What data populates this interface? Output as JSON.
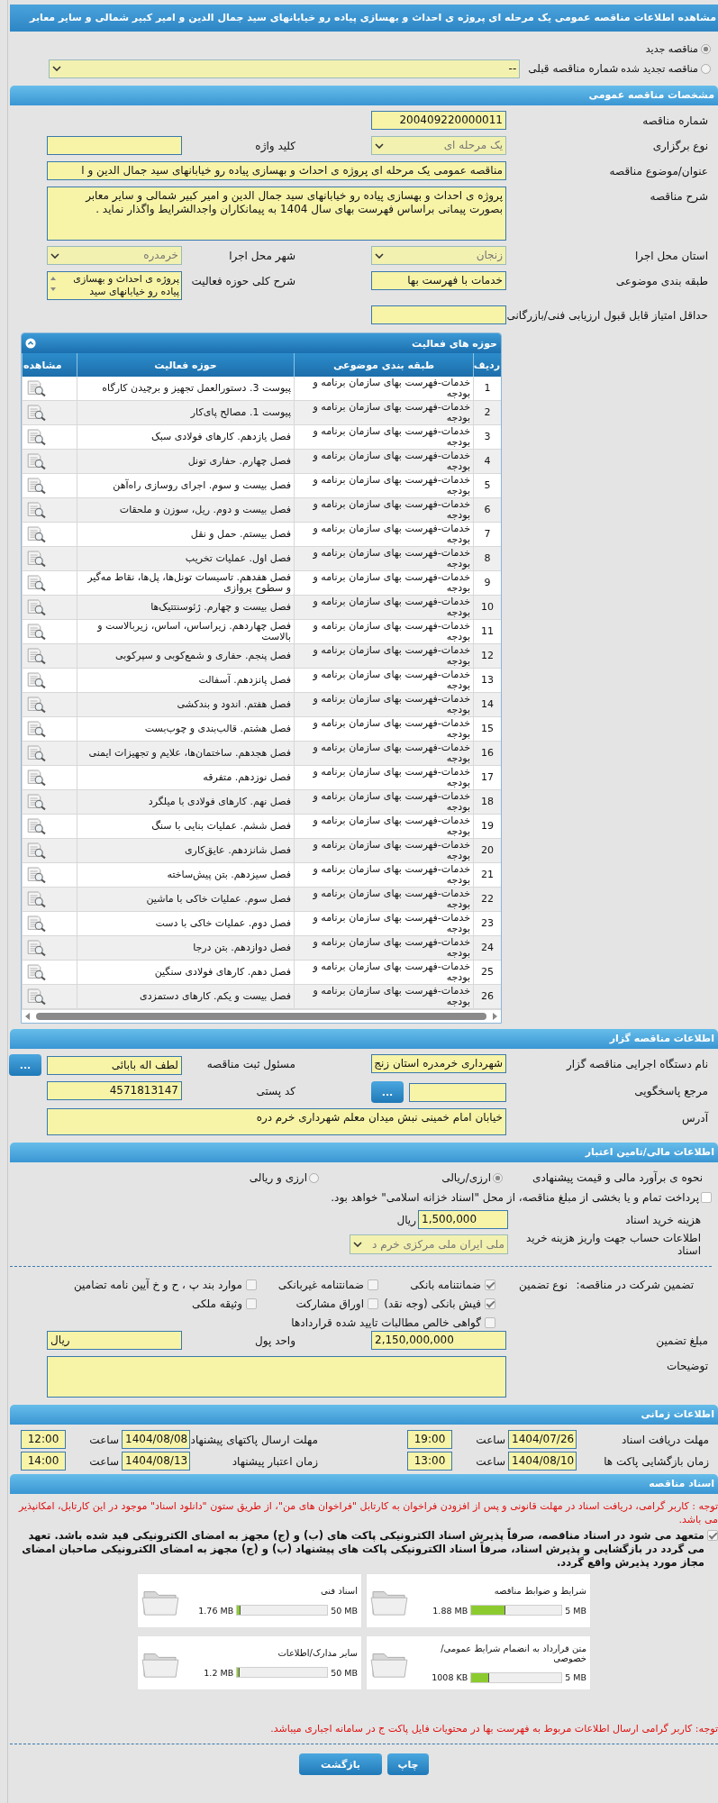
{
  "page_title": "مشاهده اطلاعات مناقصه عمومی یک مرحله ای پروژه ی احداث و بهسازی پیاده رو خیابانهای سید جمال الدین و امیر کبیر شمالی و سایر معابر",
  "tender_type_options": [
    {
      "label": "مناقصه جدید",
      "selected": true
    },
    {
      "label": "مناقصه تجدید شده",
      "selected": false
    }
  ],
  "previous_tender": {
    "label": "شماره مناقصه قبلی",
    "value": "--"
  },
  "general": {
    "heading": "مشخصات مناقصه عمومی",
    "rows": [
      {
        "right": {
          "label": "شماره مناقصه",
          "kind": "text",
          "value": "200409220000011"
        }
      },
      {
        "right": {
          "label": "نوع برگزاری",
          "kind": "select",
          "value": "یک مرحله ای",
          "disabled": true
        },
        "left": {
          "label": "کلید واژه",
          "kind": "text"
        }
      },
      {
        "wide": {
          "label": "عنوان/موضوع مناقصه",
          "kind": "text",
          "value": "مناقصه عمومی یک مرحله ای پروژه ی احداث و بهسازی پیاده رو خیابانهای سید جمال الدین و ا"
        }
      },
      {
        "wide": {
          "label": "شرح مناقصه",
          "kind": "textarea",
          "value": "پروژه ی احداث و بهسازی پیاده رو خیابانهای سید جمال الدین و امیر کبیر شمالی و سایر معابر بصورت پیمانی براساس فهرست بهای سال 1404 به پیمانکاران واجدالشرایط واگذار نماید ."
        }
      },
      {
        "right": {
          "label": "استان محل اجرا",
          "kind": "select",
          "value": "زنجان",
          "disabled": true
        },
        "left": {
          "label": "شهر محل اجرا",
          "kind": "select",
          "value": "خرمدره",
          "disabled": true
        }
      },
      {
        "right": {
          "label": "طبقه بندی موضوعی",
          "kind": "text",
          "value": "خدمات با فهرست بها"
        },
        "left": {
          "label": "شرح کلی حوزه فعالیت",
          "kind": "listbox",
          "value": "پروژه ی احداث و بهسازی پیاده رو خیابانهای سید"
        }
      },
      {
        "right": {
          "label": "حداقل امتیاز قابل قبول ارزیابی فنی/بازرگانی",
          "kind": "text"
        }
      }
    ]
  },
  "activities": {
    "heading": "حوزه های فعالیت",
    "columns": [
      "ردیف",
      "طبقه بندی موضوعی",
      "حوزه فعالیت",
      "مشاهده"
    ],
    "rows": [
      {
        "index": "1",
        "category": "خدمات-فهرست بهای سازمان برنامه و بودجه",
        "activity": "پیوست 3. دستورالعمل تجهیز و برچیدن کارگاه"
      },
      {
        "index": "2",
        "category": "خدمات-فهرست بهای سازمان برنامه و بودجه",
        "activity": "پیوست 1. مصالح پای‌کار"
      },
      {
        "index": "3",
        "category": "خدمات-فهرست بهای سازمان برنامه و بودجه",
        "activity": "فصل یازدهم. کارهای فولادی سبک"
      },
      {
        "index": "4",
        "category": "خدمات-فهرست بهای سازمان برنامه و بودجه",
        "activity": "فصل چهارم. حفاری تونل"
      },
      {
        "index": "5",
        "category": "خدمات-فهرست بهای سازمان برنامه و بودجه",
        "activity": "فصل بیست و سوم. اجرای روسازی راه‌آهن"
      },
      {
        "index": "6",
        "category": "خدمات-فهرست بهای سازمان برنامه و بودجه",
        "activity": "فصل بیست و دوم. ریل، سوزن و ملحقات"
      },
      {
        "index": "7",
        "category": "خدمات-فهرست بهای سازمان برنامه و بودجه",
        "activity": "فصل بیستم. حمل و نقل"
      },
      {
        "index": "8",
        "category": "خدمات-فهرست بهای سازمان برنامه و بودجه",
        "activity": "فصل اول. عملیات تخریب"
      },
      {
        "index": "9",
        "category": "خدمات-فهرست بهای سازمان برنامه و بودجه",
        "activity": "فصل هفدهم. تاسیسات تونل‌ها، پل‌ها، نقاط مه‌گیر و سطوح پروازی"
      },
      {
        "index": "10",
        "category": "خدمات-فهرست بهای سازمان برنامه و بودجه",
        "activity": "فصل بیست و چهارم. ژئوسنتتیک‌ها"
      },
      {
        "index": "11",
        "category": "خدمات-فهرست بهای سازمان برنامه و بودجه",
        "activity": "فصل چهاردهم. زیراساس، اساس، زیربالاست و بالاست"
      },
      {
        "index": "12",
        "category": "خدمات-فهرست بهای سازمان برنامه و بودجه",
        "activity": "فصل پنجم. حفاری و شمع‌کوبی و سپرکوبی"
      },
      {
        "index": "13",
        "category": "خدمات-فهرست بهای سازمان برنامه و بودجه",
        "activity": "فصل پانزدهم. آسفالت"
      },
      {
        "index": "14",
        "category": "خدمات-فهرست بهای سازمان برنامه و بودجه",
        "activity": "فصل هفتم. اندود و بندکشی"
      },
      {
        "index": "15",
        "category": "خدمات-فهرست بهای سازمان برنامه و بودجه",
        "activity": "فصل هشتم. قالب‌بندی و چوب‌بست"
      },
      {
        "index": "16",
        "category": "خدمات-فهرست بهای سازمان برنامه و بودجه",
        "activity": "فصل هجدهم. ساختمان‌ها، علایم و تجهیزات ایمنی"
      },
      {
        "index": "17",
        "category": "خدمات-فهرست بهای سازمان برنامه و بودجه",
        "activity": "فصل نوزدهم. متفرقه"
      },
      {
        "index": "18",
        "category": "خدمات-فهرست بهای سازمان برنامه و بودجه",
        "activity": "فصل نهم. کارهای فولادی با میلگرد"
      },
      {
        "index": "19",
        "category": "خدمات-فهرست بهای سازمان برنامه و بودجه",
        "activity": "فصل ششم. عملیات بنایی با سنگ"
      },
      {
        "index": "20",
        "category": "خدمات-فهرست بهای سازمان برنامه و بودجه",
        "activity": "فصل شانزدهم. عایق‌کاری"
      },
      {
        "index": "21",
        "category": "خدمات-فهرست بهای سازمان برنامه و بودجه",
        "activity": "فصل سیزدهم. بتن پیش‌ساخته"
      },
      {
        "index": "22",
        "category": "خدمات-فهرست بهای سازمان برنامه و بودجه",
        "activity": "فصل سوم. عملیات خاکی با ماشین"
      },
      {
        "index": "23",
        "category": "خدمات-فهرست بهای سازمان برنامه و بودجه",
        "activity": "فصل دوم. عملیات خاکی با دست"
      },
      {
        "index": "24",
        "category": "خدمات-فهرست بهای سازمان برنامه و بودجه",
        "activity": "فصل دوازدهم. بتن درجا"
      },
      {
        "index": "25",
        "category": "خدمات-فهرست بهای سازمان برنامه و بودجه",
        "activity": "فصل دهم. کارهای فولادی سنگین"
      },
      {
        "index": "26",
        "category": "خدمات-فهرست بهای سازمان برنامه و بودجه",
        "activity": "فصل بیست و یکم. کارهای دستمزدی"
      }
    ]
  },
  "tenderer": {
    "heading": "اطلاعات مناقصه گزار",
    "rows": [
      {
        "right": {
          "label": "نام دستگاه اجرایی مناقصه گزار",
          "kind": "text",
          "value": "شهرداری خرمدره استان زنج"
        },
        "left": {
          "label": "مسئول ثبت مناقصه",
          "kind": "text",
          "value": "لطف اله بابائی",
          "lookup": "..."
        }
      },
      {
        "right": {
          "label": "مرجع پاسخگویی",
          "kind": "text",
          "lookup": "..."
        },
        "left": {
          "label": "کد پستی",
          "kind": "text",
          "value": "4571813147"
        }
      },
      {
        "wide": {
          "label": "آدرس",
          "kind": "textarea",
          "value": "خیابان امام خمینی نبش میدان معلم شهرداری خرم دره"
        }
      }
    ]
  },
  "finance": {
    "heading": "اطلاعات مالی/تامین اعتبار",
    "estimate": {
      "label": "نحوه ی برآورد مالی و قیمت پیشنهادی",
      "options": [
        {
          "label": "ارزی/ریالی",
          "selected": true
        },
        {
          "label": "ارزی و ریالی",
          "selected": false
        }
      ]
    },
    "treasury": {
      "label": "پرداخت تمام و یا بخشی از مبلغ مناقصه، از محل \"اسناد خزانه اسلامی\" خواهد بود.",
      "checked": false
    },
    "doc_fee": {
      "label": "هزینه خرید اسناد",
      "value": "1,500,000",
      "unit": "ریال"
    },
    "account": {
      "label": "اطلاعات حساب جهت واریز هزینه خرید اسناد",
      "value": "ملی ایران ملی مرکزی خرم د"
    },
    "guarantee": {
      "label": "تضمین شرکت در مناقصه:",
      "type_label": "نوع تضمین",
      "options": [
        {
          "label": "ضمانتنامه بانکی",
          "checked": true
        },
        {
          "label": "ضمانتنامه غیربانکی",
          "checked": false
        },
        {
          "label": "موارد بند پ ، ح و خ آیین نامه تضامین",
          "checked": false
        },
        {
          "label": "فیش بانکی (وجه نقد)",
          "checked": true
        },
        {
          "label": "اوراق مشارکت",
          "checked": false
        },
        {
          "label": "وثیقه ملکی",
          "checked": false
        },
        {
          "label": "گواهی خالص مطالبات تایید شده قراردادها",
          "checked": false
        }
      ]
    },
    "rows": [
      {
        "right": {
          "label": "مبلغ تضمین",
          "kind": "text",
          "value": "2,150,000,000"
        },
        "left": {
          "label": "واحد پول",
          "kind": "text",
          "value": "ریال"
        }
      },
      {
        "wide": {
          "label": "توضیحات",
          "kind": "textarea"
        }
      }
    ]
  },
  "timing": {
    "heading": "اطلاعات زمانی",
    "items": [
      {
        "label": "مهلت دریافت اسناد",
        "date": "1404/07/26",
        "time_label": "ساعت",
        "time": "19:00"
      },
      {
        "label": "مهلت ارسال پاکتهای پیشنهاد",
        "date": "1404/08/08",
        "time_label": "ساعت",
        "time": "12:00"
      },
      {
        "label": "زمان بازگشایی پاکت ها",
        "date": "1404/08/10",
        "time_label": "ساعت",
        "time": "13:00"
      },
      {
        "label": "زمان اعتبار پیشنهاد",
        "date": "1404/08/13",
        "time_label": "ساعت",
        "time": "14:00"
      }
    ]
  },
  "documents": {
    "heading": "اسناد مناقصه",
    "notice": "توجه : کاربر گرامی، دریافت اسناد در مهلت قانونی و پس از افزودن فراخوان به کارتابل \"فراخوان های من\"، از طریق ستون \"دانلود اسناد\" موجود در این کارتابل، امکانپذیر می باشد.",
    "pledge": {
      "text": "متعهد می شود در اسناد مناقصه، صرفاً پذیرش اسناد الکترونیکی پاکت های (ب) و (ج) مجهز به امضای الکترونیکی قید شده باشد. تعهد می گردد در بازگشایی و پذیرش اسناد، صرفاً اسناد الکترونیکی پاکت های پیشنهاد (ب) و (ج) مجهز به امضای الکترونیکی صاحبان امضای مجاز مورد پذیرش واقع گردد.",
      "checked": true
    },
    "files": [
      {
        "title": "شرایط و ضوابط مناقصه",
        "used": "1.88 MB",
        "limit": "5 MB",
        "level": 0.376
      },
      {
        "title": "اسناد فنی",
        "used": "1.76 MB",
        "limit": "50 MB",
        "level": 0.035
      },
      {
        "title": "متن قرارداد به انضمام شرایط عمومی/خصوصی",
        "used": "1008 KB",
        "limit": "5 MB",
        "level": 0.2
      },
      {
        "title": "سایر مدارک/اطلاعات",
        "used": "1.2 MB",
        "limit": "50 MB",
        "level": 0.024
      }
    ],
    "footnote": "توجه: کاربر گرامی ارسال اطلاعات مربوط به فهرست بها در محتویات فایل پاکت ج در سامانه اجباری میباشد."
  },
  "buttons": [
    "چاپ",
    "بازگشت"
  ]
}
